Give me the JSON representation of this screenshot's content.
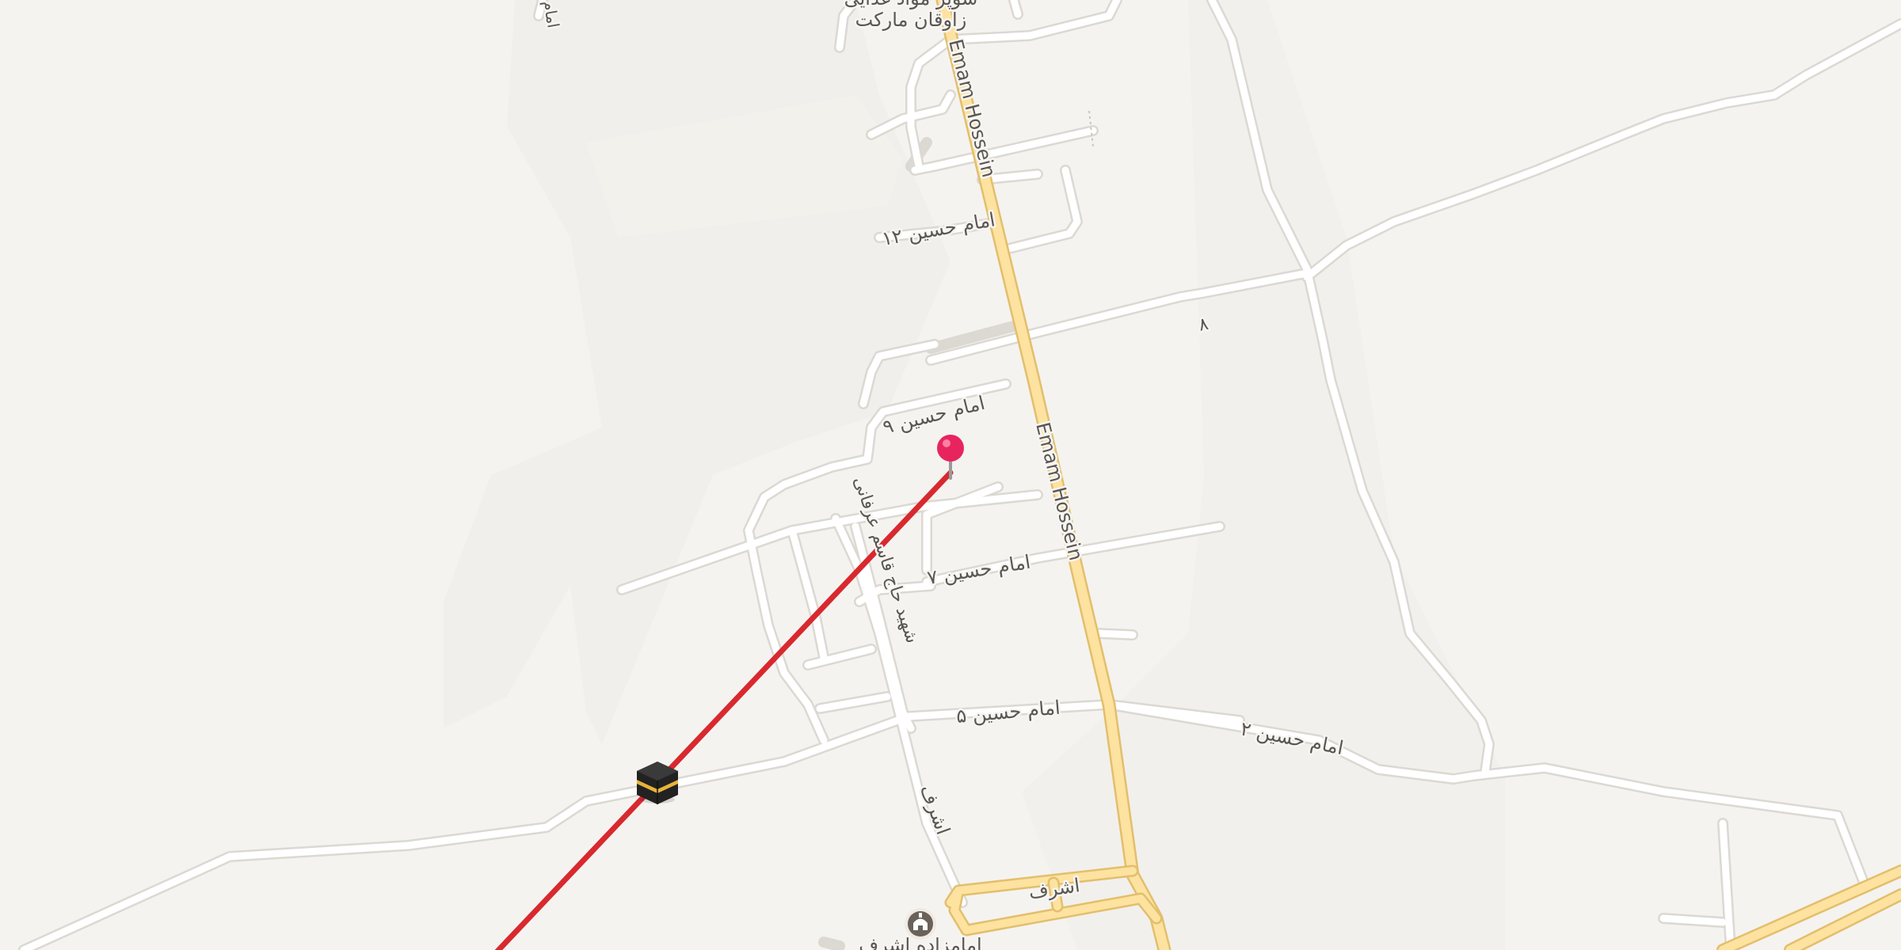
{
  "map": {
    "colors": {
      "background": "#f5f3f0",
      "block_shade": "#efede9",
      "minor_road": "#ffffff",
      "major_road": "#fde2a0",
      "qibla_line": "#d8292f",
      "pin": "#e8245e",
      "label": "#5a5651"
    },
    "street_labels": {
      "emam_hossein_north": "Emam Hossein",
      "emam_hossein_south": "Emam Hossein",
      "emam_hasan_12": "امام حسین ۱۲",
      "emam_hasan_9": "امام حسین ۹",
      "emam_hasan_8": "۸",
      "emam_hasan_7": "امام حسین ۷",
      "emam_hasan_5": "امام حسین ۵",
      "emam_hasan_2": "امام حسین ۲",
      "ashraf_vertical": "اشرف",
      "ashraf_bottom": "اشرف",
      "side_street_vertical": "شهید حاج قاسم عرفانی",
      "top_left_fragment": "امام"
    },
    "pois": {
      "market_line1": "سوپر مواد غذایی",
      "market_line2": "زاوقان مارکت",
      "shrine_label": "امامزاده اشرف"
    },
    "icons": {
      "qibla_marker": "kaaba-icon",
      "location_pin": "map-pin-icon",
      "shrine": "mosque-icon"
    }
  }
}
